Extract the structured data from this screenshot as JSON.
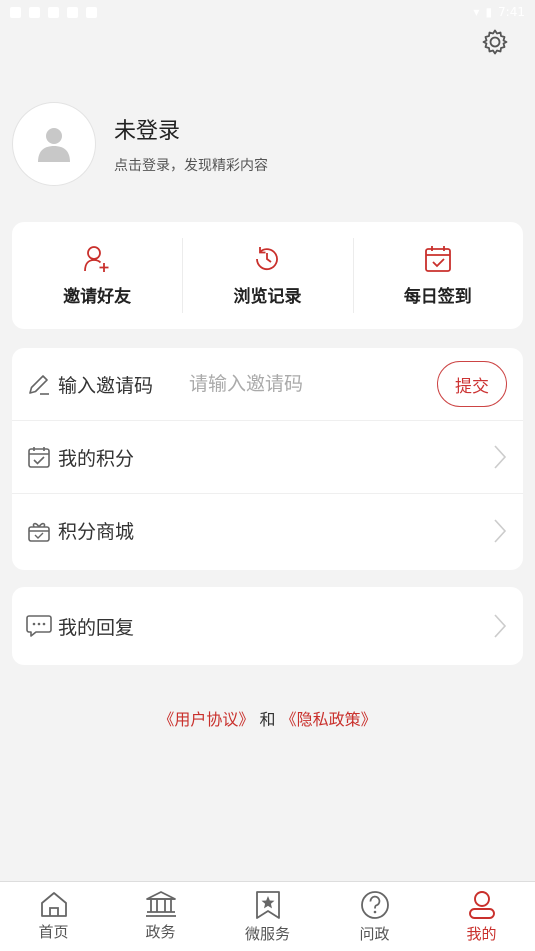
{
  "status_bar": {
    "time": "7:41"
  },
  "colors": {
    "accent": "#c9302c",
    "background": "#f3f3f3",
    "card": "#ffffff"
  },
  "header": {
    "settings_icon": "gear-icon"
  },
  "profile": {
    "name": "未登录",
    "subtitle": "点击登录，发现精彩内容",
    "avatar_icon": "user-silhouette-icon"
  },
  "quick_actions": [
    {
      "label": "邀请好友",
      "icon": "add-user-icon"
    },
    {
      "label": "浏览记录",
      "icon": "history-clock-icon"
    },
    {
      "label": "每日签到",
      "icon": "calendar-check-icon"
    }
  ],
  "invite": {
    "label": "输入邀请码",
    "placeholder": "请输入邀请码",
    "value": "",
    "submit_label": "提交",
    "icon": "pencil-icon"
  },
  "menu": [
    {
      "label": "我的积分",
      "icon": "points-calendar-icon"
    },
    {
      "label": "积分商城",
      "icon": "gift-box-icon"
    }
  ],
  "menu2": [
    {
      "label": "我的回复",
      "icon": "chat-bubble-icon"
    }
  ],
  "agreement": {
    "user_agreement": "《用户协议》",
    "and": "和",
    "privacy_policy": "《隐私政策》"
  },
  "tabs": [
    {
      "label": "首页",
      "icon": "home-icon",
      "active": false
    },
    {
      "label": "政务",
      "icon": "government-building-icon",
      "active": false
    },
    {
      "label": "微服务",
      "icon": "star-bookmark-icon",
      "active": false
    },
    {
      "label": "问政",
      "icon": "question-circle-icon",
      "active": false
    },
    {
      "label": "我的",
      "icon": "user-profile-icon",
      "active": true
    }
  ]
}
